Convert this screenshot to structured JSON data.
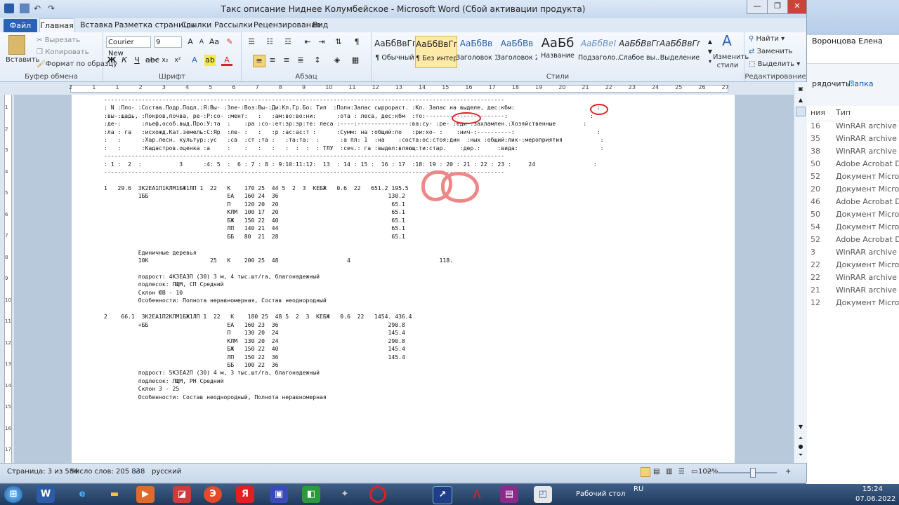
{
  "window": {
    "title": "Такс описание Ниднее Колумбейское - Microsoft Word (Сбой активации продукта)"
  },
  "tabs": [
    "Файл",
    "Главная",
    "Вставка",
    "Разметка страницы",
    "Ссылки",
    "Рассылки",
    "Рецензирование",
    "Вид"
  ],
  "clipboard": {
    "paste": "Вставить",
    "cut": "Вырезать",
    "copy": "Копировать",
    "format_painter": "Формат по образцу",
    "group": "Буфер обмена"
  },
  "font": {
    "name": "Courier New",
    "size": "9",
    "group": "Шрифт"
  },
  "paragraph": {
    "group": "Абзац"
  },
  "styles": {
    "group": "Стили",
    "items": [
      {
        "preview": "АаБбВвГг,",
        "name": "¶ Обычный"
      },
      {
        "preview": "АаБбВвГг,",
        "name": "¶ Без интер..."
      },
      {
        "preview": "АаБбВв",
        "name": "Заголовок 1"
      },
      {
        "preview": "АаБбВв",
        "name": "Заголовок 2"
      },
      {
        "preview": "АаБб",
        "name": "Название"
      },
      {
        "preview": "АаБбВеІ",
        "name": "Подзаголо..."
      },
      {
        "preview": "АаБбВвГг,",
        "name": "Слабое вы..."
      },
      {
        "preview": "АаБбВвГг,",
        "name": "Выделение"
      }
    ],
    "change": "Изменить стили"
  },
  "editing": {
    "find": "Найти",
    "replace": "Заменить",
    "select": "Выделить",
    "group": "Редактирование"
  },
  "ruler_numbers": [
    "2",
    "1",
    "1",
    "2",
    "3",
    "4",
    "5",
    "6",
    "7",
    "8",
    "9",
    "10",
    "11",
    "12",
    "13",
    "14",
    "15",
    "16",
    "17",
    "18",
    "19",
    "20",
    "21",
    "22",
    "23",
    "24",
    "25",
    "26",
    "27"
  ],
  "vruler_numbers": [
    "1",
    "2",
    "3",
    "4",
    "5",
    "6",
    "7",
    "8",
    "9",
    "10",
    "11",
    "12",
    "13",
    "14",
    "15",
    "16",
    "17"
  ],
  "document_text": "---------------------------------------------------------------------------------------------------------------------\n: N :Пло- :Состав.Подр.Подл.:Я:Вы- :Эле-:Воз:Вы-:Ди:Кл.Гр.Бо: Тип  :Полн:Запас сыррораст. :Кл. Запас на выделе, дес:кбм:                        :\n:вы-:щадь, :Покров,почва, ре-:Р:со- :мент:   :   :ам:во:во:ни:      :ота : леса, дес:кбм  :то:-----------------------:                        :\n:де-:      :льеф,особ.выд.Про:У:та  :    :ра :со-:ет:зр:зр:те: леса :----:---------------:ва:су- :ре- :еди-:захламлен.:Хозяйственные        :\n:ла : га   :исхожд.Кат.земель:С:Яр  :ле- :   :   :р :ас:ас:т :      :Сумм: на :общий:по   :ри:хо- :    :нич-:----------:                        :\n:   :      :Хар.лесн. культур::ус   :са  :ст :та :   :та:та:  :      :а пл: 1  :на    :соста:ос:стоя:дин  :ных :общий:лик-:мероприятия           :\n:   :      :Кадастров.оценка :а     :    :   :   :   :  :  :  : ТЛУ  :сеч.: га :выдел:вляющ:ти:стар.    :дер.:     :вида:                        :\n---------------------------------------------------------------------------------------------------------------------\n: 1 :  2  :           3      :4: 5  :  6 : 7 : 8 : 9:10:11:12:  13  : 14 : 15 :  16 : 17  :18: 19 : 20 : 21 : 22 : 23 :     24                 :\n---------------------------------------------------------------------------------------------------------------------\n\n1   29.6  3К2ЕА1П1КЛМ1БЖ1ЛП 1  22   К    170 25  44 5  2  3  КЕБЖ   0.6  22   651.2 195.5\n          1ББ                       ЕА   160 24  36                                130.2\n                                    П    120 20  20                                 65.1\n                                    КЛМ  100 17  20                                 65.1\n                                    БЖ   150 22  40                                 65.1\n                                    ЛП   140 21  44                                 65.1\n                                    ББ   80  21  28                                 65.1\n\n          Единичные деревья\n          10К                  25   К    200 25  48                    4                          118.\n\n          подрост: 4К3ЕА3П (30) 3 м, 4 тыс.шт/га, благонадежный\n          подлесок: ЛЩМ, СП Средний\n          Склон ЮВ - 10\n          Особенности: Полнота неравномерная, Состав неоднородный\n\n2    66.1  3К2ЕА1П2КЛМ1БЖ1ЛП 1  22   К    180 25  48 5  2  3  КЕБЖ   0.6  22   1454. 436.4\n          +ББ                       ЕА   160 23  36                                290.8\n                                    П    130 20  24                                145.4\n                                    КЛМ  130 20  24                                290.8\n                                    БЖ   150 22  40                                145.4\n                                    ЛП   150 22  36                                145.4\n                                    ББ   100 22  36\n          подрост: 5К3ЕА2П (30) 4 м, 3 тыс.шт/га, благонадежный\n          подлесок: ЛЩМ, РН Средний\n          Склон З - 25\n          Особенности: Состав неоднородный, Полнота неравномерная",
  "status": {
    "page": "Страница: 3 из 584",
    "words": "Число слов: 205 838",
    "language": "русский",
    "zoom": "102%",
    "zoom_level": 0.6
  },
  "explorer": {
    "user": "Воронцова Елена",
    "sort_label": "рядочить:",
    "folder": "Папка",
    "col_name": "ния",
    "col_type": "Тип",
    "rows": [
      {
        "num": "16",
        "type": "WinRAR archive"
      },
      {
        "num": "35",
        "type": "WinRAR archive"
      },
      {
        "num": "38",
        "type": "WinRAR archive"
      },
      {
        "num": "50",
        "type": "Adobe Acrobat D..."
      },
      {
        "num": "52",
        "type": "Документ Microso..."
      },
      {
        "num": "20",
        "type": "Документ Microso..."
      },
      {
        "num": "46",
        "type": "Adobe Acrobat D..."
      },
      {
        "num": "50",
        "type": "Документ Microso..."
      },
      {
        "num": "54",
        "type": "Документ Microso..."
      },
      {
        "num": "52",
        "type": "Adobe Acrobat D..."
      },
      {
        "num": "3",
        "type": "WinRAR archive"
      },
      {
        "num": "22",
        "type": "Документ Microso..."
      },
      {
        "num": "22",
        "type": "WinRAR archive"
      },
      {
        "num": "21",
        "type": "WinRAR archive"
      },
      {
        "num": "12",
        "type": "Документ Microso..."
      }
    ]
  },
  "taskbar": {
    "desktop": "Рабочий стол",
    "lang": "RU",
    "time": "15:24",
    "date": "07.06.2022"
  },
  "colors": {
    "accent": "#2a62b5",
    "annotation": "#e02020",
    "annotation_pink": "#ee8888"
  }
}
